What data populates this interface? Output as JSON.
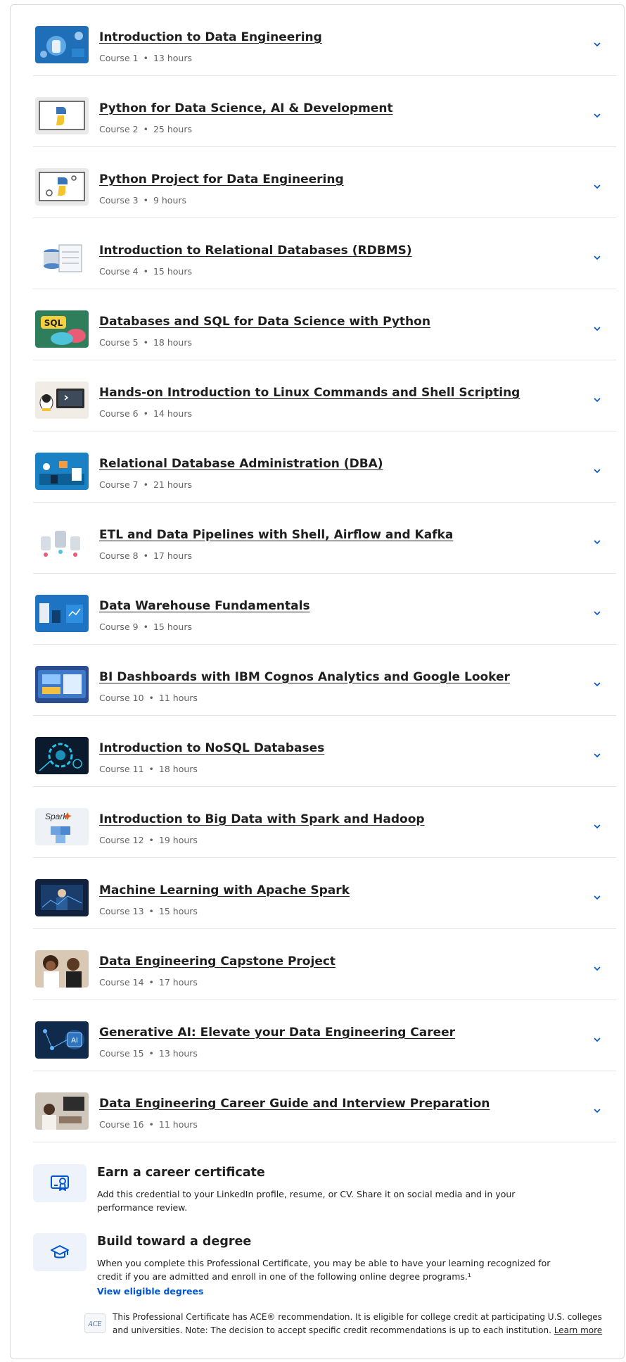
{
  "courses": [
    {
      "title": "Introduction to Data Engineering",
      "course": "Course 1",
      "hours": "13 hours"
    },
    {
      "title": "Python for Data Science, AI & Development",
      "course": "Course 2",
      "hours": "25 hours"
    },
    {
      "title": "Python Project for Data Engineering",
      "course": "Course 3",
      "hours": "9 hours"
    },
    {
      "title": "Introduction to Relational Databases (RDBMS)",
      "course": "Course 4",
      "hours": "15 hours"
    },
    {
      "title": "Databases and SQL for Data Science with Python",
      "course": "Course 5",
      "hours": "18 hours"
    },
    {
      "title": "Hands-on Introduction to Linux Commands and Shell Scripting",
      "course": "Course 6",
      "hours": "14 hours"
    },
    {
      "title": "Relational Database Administration (DBA)",
      "course": "Course 7",
      "hours": "21 hours"
    },
    {
      "title": "ETL and Data Pipelines with Shell, Airflow and Kafka",
      "course": "Course 8",
      "hours": "17 hours"
    },
    {
      "title": "Data Warehouse Fundamentals",
      "course": "Course 9",
      "hours": "15 hours"
    },
    {
      "title": "BI Dashboards with IBM Cognos Analytics and Google Looker",
      "course": "Course 10",
      "hours": "11 hours"
    },
    {
      "title": "Introduction to NoSQL Databases",
      "course": "Course 11",
      "hours": "18 hours"
    },
    {
      "title": "Introduction to Big Data with Spark and Hadoop",
      "course": "Course 12",
      "hours": "19 hours"
    },
    {
      "title": "Machine Learning with Apache Spark",
      "course": "Course 13",
      "hours": "15 hours"
    },
    {
      "title": "Data Engineering Capstone Project",
      "course": "Course 14",
      "hours": "17 hours"
    },
    {
      "title": "Generative AI: Elevate your Data Engineering Career",
      "course": "Course 15",
      "hours": "13 hours"
    },
    {
      "title": "Data Engineering Career Guide and Interview Preparation",
      "course": "Course 16",
      "hours": "11 hours"
    }
  ],
  "thumbnail_labels": {
    "sql": "SQL",
    "spark": "Spark",
    "ai": "AI"
  },
  "bullet": "•",
  "certificate": {
    "title": "Earn a career certificate",
    "line1": "Add this credential to your LinkedIn profile, resume, or CV. Share it on social media and in your",
    "line2": "performance review."
  },
  "degree": {
    "title": "Build toward a degree",
    "line1": "When you complete this Professional Certificate, you may be able to have your learning recognized for",
    "line2": "credit if you are admitted and enroll in one of the following online degree programs.¹",
    "link": "View eligible degrees"
  },
  "ace": {
    "logo_text": "ACE",
    "line1": "This Professional Certificate has ACE® recommendation. It is eligible for college credit at participating U.S. colleges",
    "line2": "and universities. Note: The decision to accept specific credit recommendations is up to each institution.",
    "learn_more": "Learn more"
  },
  "colors": {
    "accent": "#0056d2",
    "title_text": "#1f1f1f",
    "meta_text": "#636363",
    "divider": "#e1e3e6",
    "icon_box": "#eef3fb"
  }
}
